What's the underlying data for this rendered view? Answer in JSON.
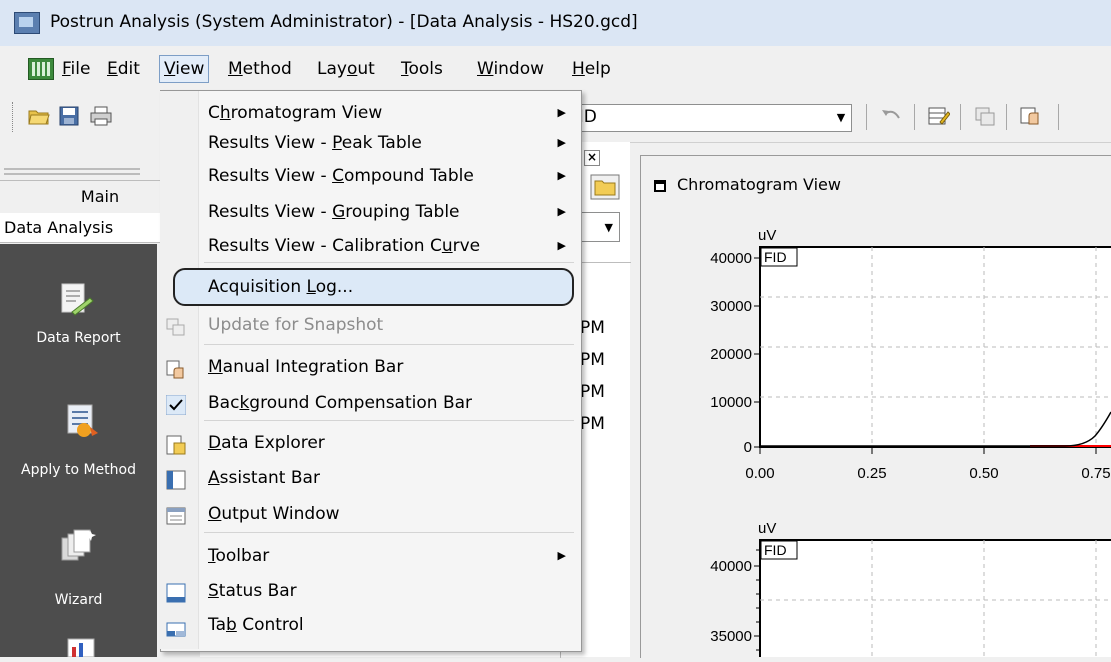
{
  "window": {
    "title": "Postrun Analysis (System Administrator) - [Data Analysis - HS20.gcd]"
  },
  "menubar": [
    {
      "pre": "",
      "m": "F",
      "post": "ile"
    },
    {
      "pre": "",
      "m": "E",
      "post": "dit"
    },
    {
      "pre": "",
      "m": "V",
      "post": "iew"
    },
    {
      "pre": "",
      "m": "M",
      "post": "ethod"
    },
    {
      "pre": "Lay",
      "m": "o",
      "post": "ut"
    },
    {
      "pre": "",
      "m": "T",
      "post": "ools"
    },
    {
      "pre": "",
      "m": "W",
      "post": "indow"
    },
    {
      "pre": "",
      "m": "H",
      "post": "elp"
    }
  ],
  "toolbar": {
    "combo_value": "FID"
  },
  "leftpane": {
    "tab_main": "Main",
    "tab_data_analysis": "Data Analysis",
    "items": [
      "Data Report",
      "Apply to Method",
      "Wizard"
    ]
  },
  "midpane": {
    "pm_labels": [
      "PM",
      "PM",
      "PM",
      "PM"
    ]
  },
  "view_menu": {
    "items": [
      {
        "pre": "C",
        "m": "h",
        "post": "romatogram View",
        "submenu": true
      },
      {
        "pre": "Results View - ",
        "m": "P",
        "post": "eak Table",
        "submenu": true
      },
      {
        "pre": "Results View - ",
        "m": "C",
        "post": "ompound Table",
        "submenu": true
      },
      {
        "pre": "Results View - ",
        "m": "G",
        "post": "rouping Table",
        "submenu": true
      },
      {
        "pre": "Results View - Calibration C",
        "m": "u",
        "post": "rve",
        "submenu": true
      },
      {
        "pre": "Acquisition ",
        "m": "L",
        "post": "og...",
        "highlighted": true
      },
      {
        "pre": "Update for Snapshot",
        "m": "",
        "post": "",
        "disabled": true
      },
      {
        "pre": "",
        "m": "M",
        "post": "anual Integration Bar"
      },
      {
        "pre": "Bac",
        "m": "k",
        "post": "ground Compensation Bar",
        "checked": true
      },
      {
        "pre": "",
        "m": "D",
        "post": "ata Explorer"
      },
      {
        "pre": "",
        "m": "A",
        "post": "ssistant Bar"
      },
      {
        "pre": "",
        "m": "O",
        "post": "utput Window"
      },
      {
        "pre": "",
        "m": "T",
        "post": "oolbar",
        "submenu": true
      },
      {
        "pre": "",
        "m": "S",
        "post": "tatus Bar"
      },
      {
        "pre": "Ta",
        "m": "b",
        "post": " Control"
      }
    ]
  },
  "chart": {
    "title": "Chromatogram View",
    "top_plot": {
      "unit": "uV",
      "label": "FID",
      "y_ticks": [
        "40000",
        "30000",
        "20000",
        "10000",
        "0"
      ],
      "x_ticks": [
        "0.00",
        "0.25",
        "0.50",
        "0.75"
      ]
    },
    "bottom_plot": {
      "unit": "uV",
      "label": "FID",
      "y_ticks": [
        "40000",
        "35000"
      ]
    }
  },
  "colors": {
    "highlight": "#dce9f7",
    "sidebar": "#4d4d4d",
    "baseline": "#ff0000"
  }
}
